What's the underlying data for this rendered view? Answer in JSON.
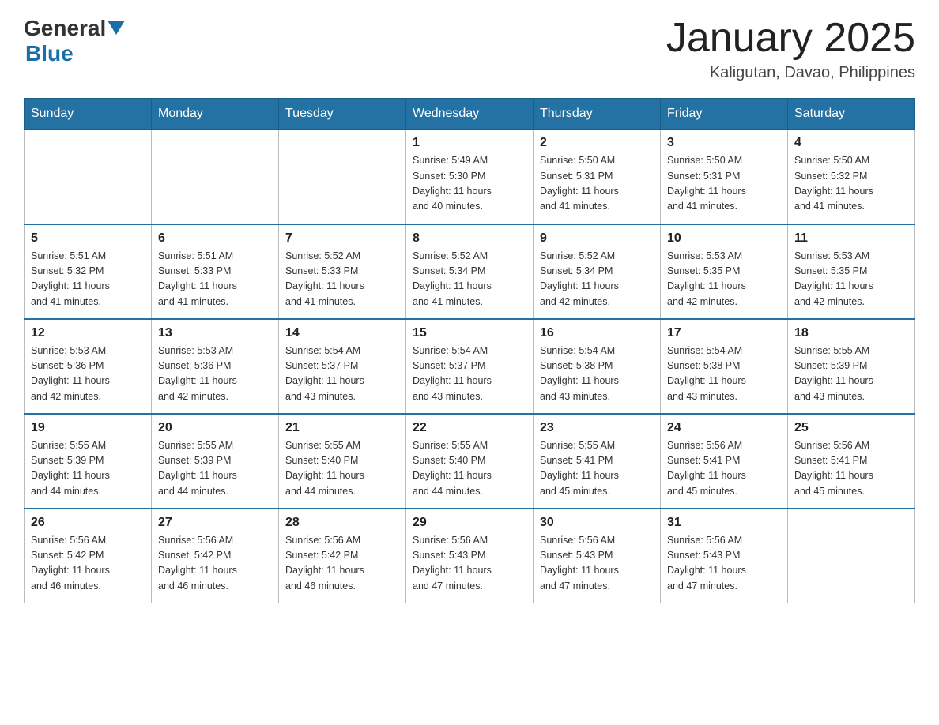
{
  "header": {
    "logo": {
      "general": "General",
      "blue": "Blue"
    },
    "title": "January 2025",
    "location": "Kaligutan, Davao, Philippines"
  },
  "weekdays": [
    "Sunday",
    "Monday",
    "Tuesday",
    "Wednesday",
    "Thursday",
    "Friday",
    "Saturday"
  ],
  "weeks": [
    [
      {
        "day": "",
        "info": ""
      },
      {
        "day": "",
        "info": ""
      },
      {
        "day": "",
        "info": ""
      },
      {
        "day": "1",
        "info": "Sunrise: 5:49 AM\nSunset: 5:30 PM\nDaylight: 11 hours\nand 40 minutes."
      },
      {
        "day": "2",
        "info": "Sunrise: 5:50 AM\nSunset: 5:31 PM\nDaylight: 11 hours\nand 41 minutes."
      },
      {
        "day": "3",
        "info": "Sunrise: 5:50 AM\nSunset: 5:31 PM\nDaylight: 11 hours\nand 41 minutes."
      },
      {
        "day": "4",
        "info": "Sunrise: 5:50 AM\nSunset: 5:32 PM\nDaylight: 11 hours\nand 41 minutes."
      }
    ],
    [
      {
        "day": "5",
        "info": "Sunrise: 5:51 AM\nSunset: 5:32 PM\nDaylight: 11 hours\nand 41 minutes."
      },
      {
        "day": "6",
        "info": "Sunrise: 5:51 AM\nSunset: 5:33 PM\nDaylight: 11 hours\nand 41 minutes."
      },
      {
        "day": "7",
        "info": "Sunrise: 5:52 AM\nSunset: 5:33 PM\nDaylight: 11 hours\nand 41 minutes."
      },
      {
        "day": "8",
        "info": "Sunrise: 5:52 AM\nSunset: 5:34 PM\nDaylight: 11 hours\nand 41 minutes."
      },
      {
        "day": "9",
        "info": "Sunrise: 5:52 AM\nSunset: 5:34 PM\nDaylight: 11 hours\nand 42 minutes."
      },
      {
        "day": "10",
        "info": "Sunrise: 5:53 AM\nSunset: 5:35 PM\nDaylight: 11 hours\nand 42 minutes."
      },
      {
        "day": "11",
        "info": "Sunrise: 5:53 AM\nSunset: 5:35 PM\nDaylight: 11 hours\nand 42 minutes."
      }
    ],
    [
      {
        "day": "12",
        "info": "Sunrise: 5:53 AM\nSunset: 5:36 PM\nDaylight: 11 hours\nand 42 minutes."
      },
      {
        "day": "13",
        "info": "Sunrise: 5:53 AM\nSunset: 5:36 PM\nDaylight: 11 hours\nand 42 minutes."
      },
      {
        "day": "14",
        "info": "Sunrise: 5:54 AM\nSunset: 5:37 PM\nDaylight: 11 hours\nand 43 minutes."
      },
      {
        "day": "15",
        "info": "Sunrise: 5:54 AM\nSunset: 5:37 PM\nDaylight: 11 hours\nand 43 minutes."
      },
      {
        "day": "16",
        "info": "Sunrise: 5:54 AM\nSunset: 5:38 PM\nDaylight: 11 hours\nand 43 minutes."
      },
      {
        "day": "17",
        "info": "Sunrise: 5:54 AM\nSunset: 5:38 PM\nDaylight: 11 hours\nand 43 minutes."
      },
      {
        "day": "18",
        "info": "Sunrise: 5:55 AM\nSunset: 5:39 PM\nDaylight: 11 hours\nand 43 minutes."
      }
    ],
    [
      {
        "day": "19",
        "info": "Sunrise: 5:55 AM\nSunset: 5:39 PM\nDaylight: 11 hours\nand 44 minutes."
      },
      {
        "day": "20",
        "info": "Sunrise: 5:55 AM\nSunset: 5:39 PM\nDaylight: 11 hours\nand 44 minutes."
      },
      {
        "day": "21",
        "info": "Sunrise: 5:55 AM\nSunset: 5:40 PM\nDaylight: 11 hours\nand 44 minutes."
      },
      {
        "day": "22",
        "info": "Sunrise: 5:55 AM\nSunset: 5:40 PM\nDaylight: 11 hours\nand 44 minutes."
      },
      {
        "day": "23",
        "info": "Sunrise: 5:55 AM\nSunset: 5:41 PM\nDaylight: 11 hours\nand 45 minutes."
      },
      {
        "day": "24",
        "info": "Sunrise: 5:56 AM\nSunset: 5:41 PM\nDaylight: 11 hours\nand 45 minutes."
      },
      {
        "day": "25",
        "info": "Sunrise: 5:56 AM\nSunset: 5:41 PM\nDaylight: 11 hours\nand 45 minutes."
      }
    ],
    [
      {
        "day": "26",
        "info": "Sunrise: 5:56 AM\nSunset: 5:42 PM\nDaylight: 11 hours\nand 46 minutes."
      },
      {
        "day": "27",
        "info": "Sunrise: 5:56 AM\nSunset: 5:42 PM\nDaylight: 11 hours\nand 46 minutes."
      },
      {
        "day": "28",
        "info": "Sunrise: 5:56 AM\nSunset: 5:42 PM\nDaylight: 11 hours\nand 46 minutes."
      },
      {
        "day": "29",
        "info": "Sunrise: 5:56 AM\nSunset: 5:43 PM\nDaylight: 11 hours\nand 47 minutes."
      },
      {
        "day": "30",
        "info": "Sunrise: 5:56 AM\nSunset: 5:43 PM\nDaylight: 11 hours\nand 47 minutes."
      },
      {
        "day": "31",
        "info": "Sunrise: 5:56 AM\nSunset: 5:43 PM\nDaylight: 11 hours\nand 47 minutes."
      },
      {
        "day": "",
        "info": ""
      }
    ]
  ]
}
